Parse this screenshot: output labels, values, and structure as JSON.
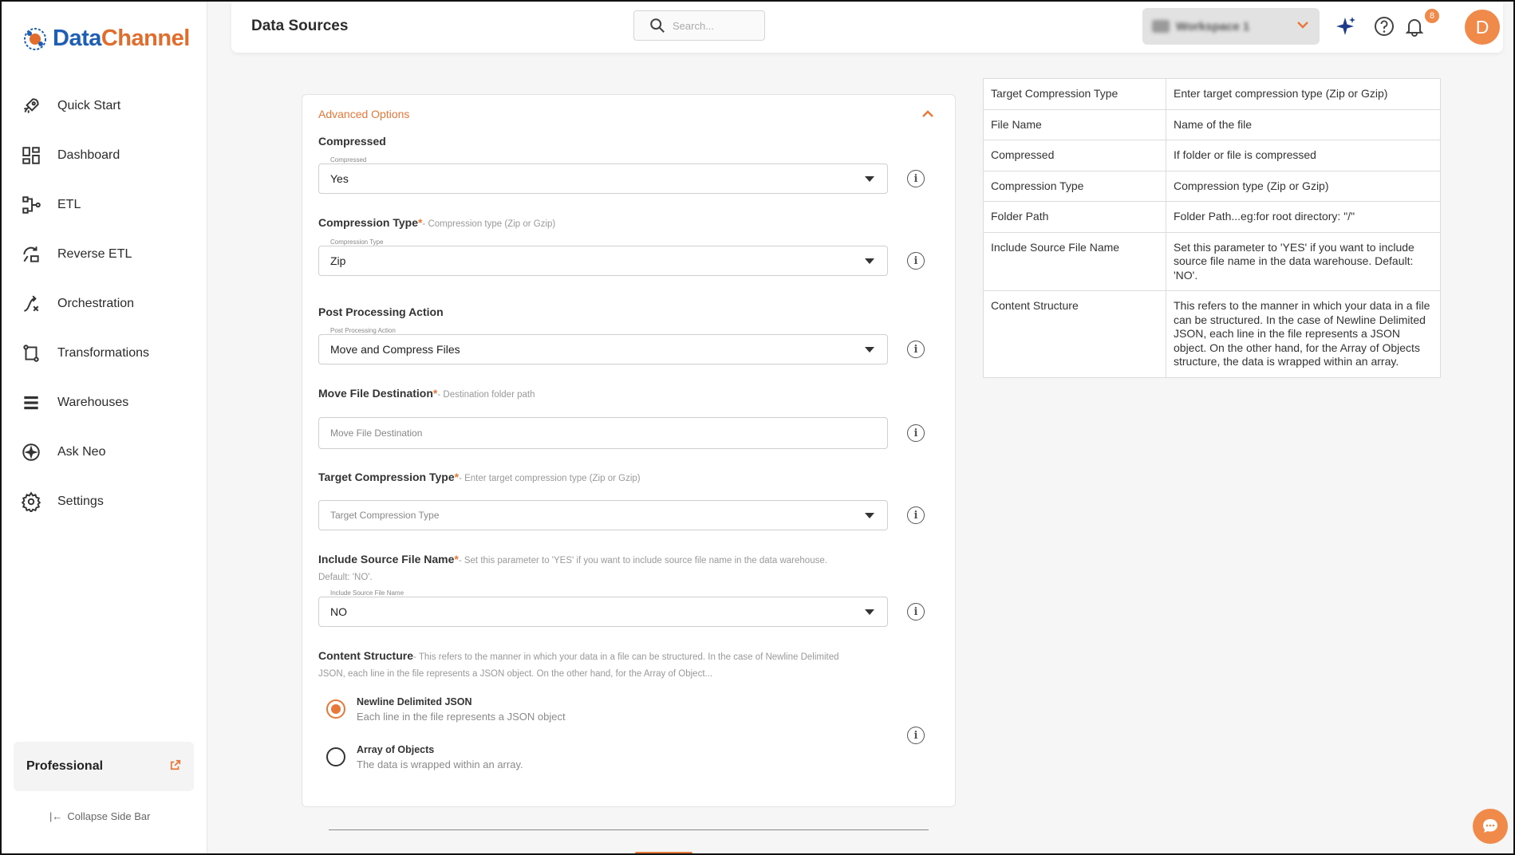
{
  "app": {
    "logo_part1": "Data",
    "logo_part2": "Channel"
  },
  "sidebar": {
    "items": [
      {
        "label": "Quick Start",
        "icon": "rocket-icon"
      },
      {
        "label": "Dashboard",
        "icon": "dashboard-icon"
      },
      {
        "label": "ETL",
        "icon": "etl-icon"
      },
      {
        "label": "Reverse ETL",
        "icon": "reverse-etl-icon"
      },
      {
        "label": "Orchestration",
        "icon": "orchestration-icon"
      },
      {
        "label": "Transformations",
        "icon": "transformations-icon"
      },
      {
        "label": "Warehouses",
        "icon": "warehouses-icon"
      },
      {
        "label": "Ask Neo",
        "icon": "sparkle-icon"
      },
      {
        "label": "Settings",
        "icon": "gear-icon"
      }
    ],
    "plan": "Professional",
    "collapse": "Collapse Side Bar"
  },
  "header": {
    "title": "Data Sources",
    "search_placeholder": "Search...",
    "workspace_name": "Workspace 1",
    "notifications_count": "8",
    "avatar_initial": "D"
  },
  "form": {
    "section": "Advanced Options",
    "compressed": {
      "label": "Compressed",
      "floating": "Compressed",
      "value": "Yes"
    },
    "compression_type": {
      "label": "Compression Type",
      "required": "*",
      "hint": "- Compression type (Zip or Gzip)",
      "floating": "Compression Type",
      "value": "Zip"
    },
    "post_processing": {
      "label": "Post Processing Action",
      "floating": "Post Processing Action",
      "value": "Move and Compress Files"
    },
    "move_destination": {
      "label": "Move File Destination",
      "required": "*",
      "hint": "- Destination folder path",
      "placeholder": "Move File Destination"
    },
    "target_compression": {
      "label": "Target Compression Type",
      "required": "*",
      "hint": "- Enter target compression type (Zip or Gzip)",
      "placeholder": "Target Compression Type"
    },
    "include_source": {
      "label": "Include Source File Name",
      "required": "*",
      "hint": "- Set this parameter to 'YES' if you want to include source file name in the data warehouse. Default: 'NO'.",
      "floating": "Include Source File Name",
      "value": "NO"
    },
    "content_structure": {
      "label": "Content Structure",
      "hint": "- This refers to the manner in which your data in a file can be structured. In the case of Newline Delimited JSON, each line in the file represents a JSON object. On the other hand, for the Array of Object...",
      "options": [
        {
          "title": "Newline Delimited JSON",
          "desc": "Each line in the file represents a JSON object",
          "selected": true
        },
        {
          "title": "Array of Objects",
          "desc": "The data is wrapped within an array.",
          "selected": false
        }
      ]
    }
  },
  "help_table": [
    {
      "name": "Target Compression Type",
      "desc": "Enter target compression type (Zip or Gzip)"
    },
    {
      "name": "File Name",
      "desc": "Name of the file"
    },
    {
      "name": "Compressed",
      "desc": "If folder or file is compressed"
    },
    {
      "name": "Compression Type",
      "desc": "Compression type (Zip or Gzip)"
    },
    {
      "name": "Folder Path",
      "desc": "Folder Path...eg:for root directory: \"/\""
    },
    {
      "name": "Include Source File Name",
      "desc": "Set this parameter to 'YES' if you want to include source file name in the data warehouse. Default: 'NO'."
    },
    {
      "name": "Content Structure",
      "desc": "This refers to the manner in which your data in a file can be structured. In the case of Newline Delimited JSON, each line in the file represents a JSON object. On the other hand, for the Array of Objects structure, the data is wrapped within an array."
    }
  ],
  "colors": {
    "accent": "#e8773a",
    "brand_blue": "#1e5fb4"
  }
}
